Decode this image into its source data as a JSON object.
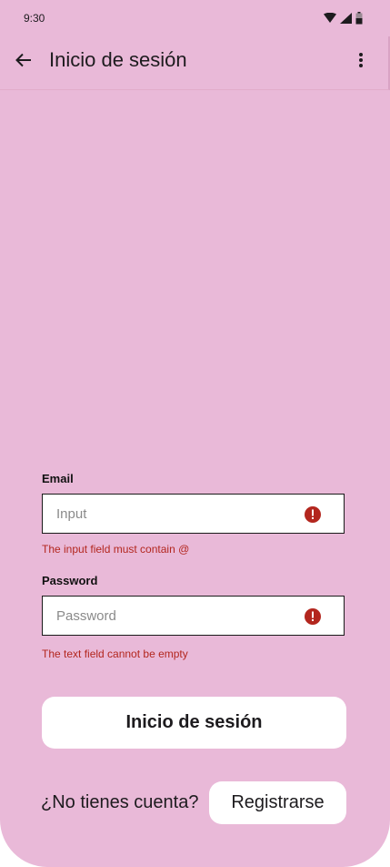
{
  "status_bar": {
    "time": "9:30",
    "icons": [
      "wifi-icon",
      "signal-icon",
      "battery-icon"
    ]
  },
  "app_bar": {
    "title": "Inicio de sesión",
    "back_icon": "arrow-back-icon",
    "menu_icon": "more-vert-icon"
  },
  "form": {
    "email": {
      "label": "Email",
      "placeholder": "Input",
      "value": "",
      "error": "The input field must contain @",
      "error_icon": "error-icon"
    },
    "password": {
      "label": "Password",
      "placeholder": "Password",
      "value": "",
      "error": "The text field cannot be empty",
      "error_icon": "error-icon"
    },
    "submit_label": "Inicio de sesión"
  },
  "footer": {
    "prompt": "¿No tienes cuenta?",
    "register_label": "Registrarse"
  },
  "colors": {
    "background": "#e9b9d8",
    "error": "#b3261e",
    "surface": "#ffffff"
  }
}
